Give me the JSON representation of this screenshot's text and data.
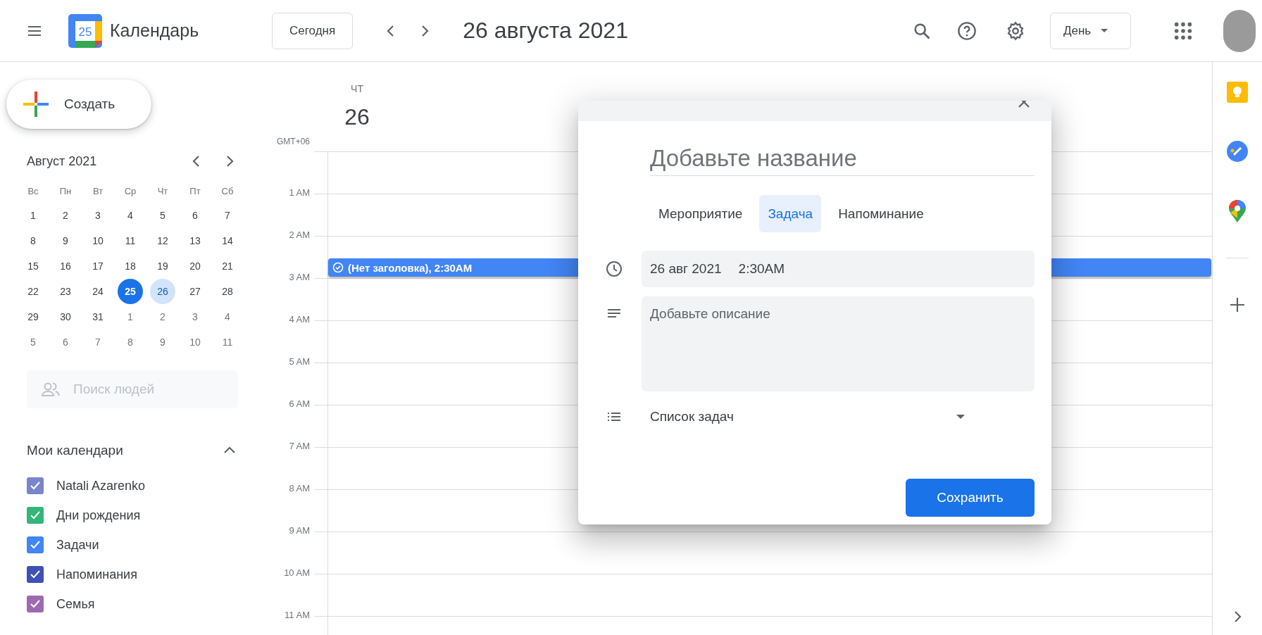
{
  "header": {
    "logo_text": "25",
    "app_name": "Календарь",
    "today_button": "Сегодня",
    "date_title": "26 августа 2021",
    "view_select": "День"
  },
  "create_button": "Создать",
  "mini_calendar": {
    "title": "Август 2021",
    "weekdays": [
      "Вс",
      "Пн",
      "Вт",
      "Ср",
      "Чт",
      "Пт",
      "Сб"
    ],
    "days": [
      {
        "label": "1",
        "outside": false,
        "today": false,
        "selected": false
      },
      {
        "label": "2",
        "outside": false,
        "today": false,
        "selected": false
      },
      {
        "label": "3",
        "outside": false,
        "today": false,
        "selected": false
      },
      {
        "label": "4",
        "outside": false,
        "today": false,
        "selected": false
      },
      {
        "label": "5",
        "outside": false,
        "today": false,
        "selected": false
      },
      {
        "label": "6",
        "outside": false,
        "today": false,
        "selected": false
      },
      {
        "label": "7",
        "outside": false,
        "today": false,
        "selected": false
      },
      {
        "label": "8",
        "outside": false,
        "today": false,
        "selected": false
      },
      {
        "label": "9",
        "outside": false,
        "today": false,
        "selected": false
      },
      {
        "label": "10",
        "outside": false,
        "today": false,
        "selected": false
      },
      {
        "label": "11",
        "outside": false,
        "today": false,
        "selected": false
      },
      {
        "label": "12",
        "outside": false,
        "today": false,
        "selected": false
      },
      {
        "label": "13",
        "outside": false,
        "today": false,
        "selected": false
      },
      {
        "label": "14",
        "outside": false,
        "today": false,
        "selected": false
      },
      {
        "label": "15",
        "outside": false,
        "today": false,
        "selected": false
      },
      {
        "label": "16",
        "outside": false,
        "today": false,
        "selected": false
      },
      {
        "label": "17",
        "outside": false,
        "today": false,
        "selected": false
      },
      {
        "label": "18",
        "outside": false,
        "today": false,
        "selected": false
      },
      {
        "label": "19",
        "outside": false,
        "today": false,
        "selected": false
      },
      {
        "label": "20",
        "outside": false,
        "today": false,
        "selected": false
      },
      {
        "label": "21",
        "outside": false,
        "today": false,
        "selected": false
      },
      {
        "label": "22",
        "outside": false,
        "today": false,
        "selected": false
      },
      {
        "label": "23",
        "outside": false,
        "today": false,
        "selected": false
      },
      {
        "label": "24",
        "outside": false,
        "today": false,
        "selected": false
      },
      {
        "label": "25",
        "outside": false,
        "today": true,
        "selected": false
      },
      {
        "label": "26",
        "outside": false,
        "today": false,
        "selected": true
      },
      {
        "label": "27",
        "outside": false,
        "today": false,
        "selected": false
      },
      {
        "label": "28",
        "outside": false,
        "today": false,
        "selected": false
      },
      {
        "label": "29",
        "outside": false,
        "today": false,
        "selected": false
      },
      {
        "label": "30",
        "outside": false,
        "today": false,
        "selected": false
      },
      {
        "label": "31",
        "outside": false,
        "today": false,
        "selected": false
      },
      {
        "label": "1",
        "outside": true,
        "today": false,
        "selected": false
      },
      {
        "label": "2",
        "outside": true,
        "today": false,
        "selected": false
      },
      {
        "label": "3",
        "outside": true,
        "today": false,
        "selected": false
      },
      {
        "label": "4",
        "outside": true,
        "today": false,
        "selected": false
      },
      {
        "label": "5",
        "outside": true,
        "today": false,
        "selected": false
      },
      {
        "label": "6",
        "outside": true,
        "today": false,
        "selected": false
      },
      {
        "label": "7",
        "outside": true,
        "today": false,
        "selected": false
      },
      {
        "label": "8",
        "outside": true,
        "today": false,
        "selected": false
      },
      {
        "label": "9",
        "outside": true,
        "today": false,
        "selected": false
      },
      {
        "label": "10",
        "outside": true,
        "today": false,
        "selected": false
      },
      {
        "label": "11",
        "outside": true,
        "today": false,
        "selected": false
      }
    ]
  },
  "people_search": {
    "placeholder": "Поиск людей"
  },
  "my_calendars": {
    "title": "Мои календари",
    "expanded": true,
    "items": [
      {
        "name": "Natali Azarenko",
        "color": "#7986cb",
        "checked": true
      },
      {
        "name": "Дни рождения",
        "color": "#33b679",
        "checked": true
      },
      {
        "name": "Задачи",
        "color": "#4285f4",
        "checked": true
      },
      {
        "name": "Напоминания",
        "color": "#3f51b5",
        "checked": true
      },
      {
        "name": "Семья",
        "color": "#9e69af",
        "checked": true
      }
    ]
  },
  "day_view": {
    "weekday": "ЧТ",
    "day": "26",
    "timezone": "GMT+06",
    "hours": [
      "1 AM",
      "2 AM",
      "3 AM",
      "4 AM",
      "5 AM",
      "6 AM",
      "7 AM",
      "8 AM",
      "9 AM",
      "10 AM",
      "11 AM"
    ],
    "events": [
      {
        "title": "(Нет заголовка), 2:30AM",
        "kind": "task"
      }
    ]
  },
  "task_dialog": {
    "title_placeholder": "Добавьте название",
    "tabs": [
      {
        "label": "Мероприятие",
        "selected": false
      },
      {
        "label": "Задача",
        "selected": true
      },
      {
        "label": "Напоминание",
        "selected": false
      }
    ],
    "date": "26 авг 2021",
    "time": "2:30AM",
    "description_placeholder": "Добавьте описание",
    "task_list": "Список задач",
    "save_button": "Сохранить"
  }
}
